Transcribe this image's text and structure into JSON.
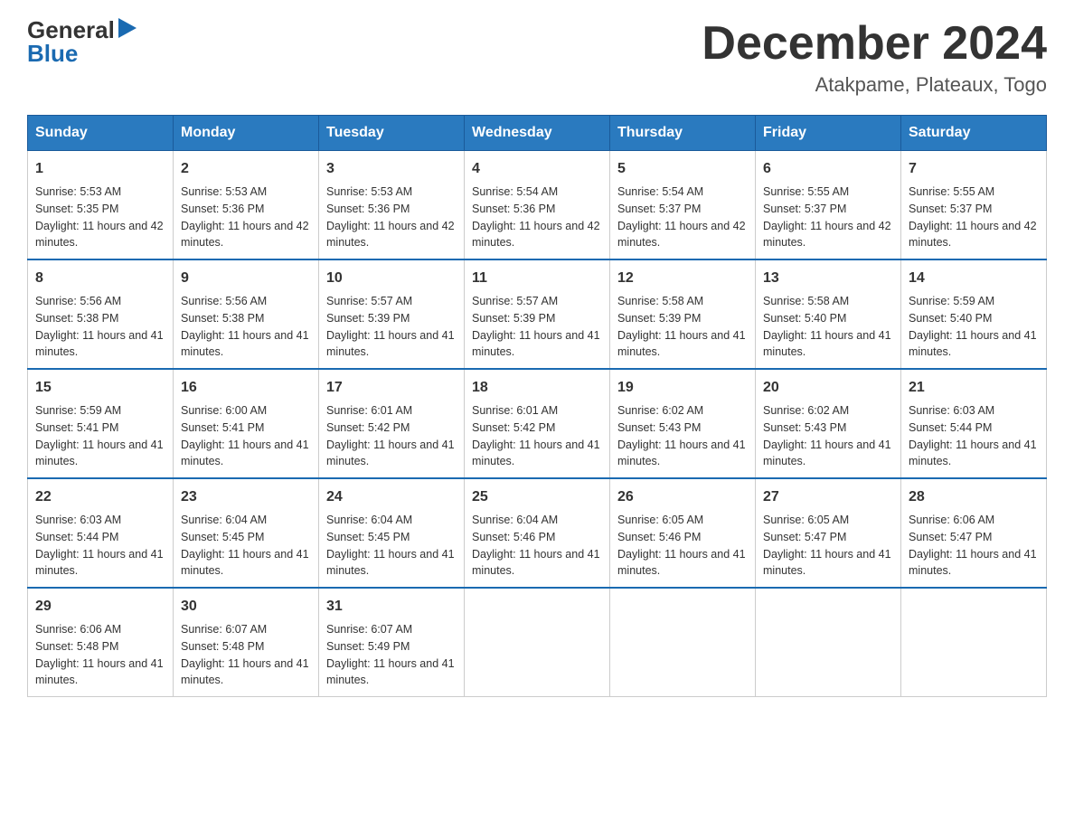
{
  "header": {
    "logo_text_general": "General",
    "logo_text_blue": "Blue",
    "month_title": "December 2024",
    "location": "Atakpame, Plateaux, Togo"
  },
  "weekdays": [
    "Sunday",
    "Monday",
    "Tuesday",
    "Wednesday",
    "Thursday",
    "Friday",
    "Saturday"
  ],
  "weeks": [
    [
      {
        "day": "1",
        "sunrise": "5:53 AM",
        "sunset": "5:35 PM",
        "daylight": "11 hours and 42 minutes."
      },
      {
        "day": "2",
        "sunrise": "5:53 AM",
        "sunset": "5:36 PM",
        "daylight": "11 hours and 42 minutes."
      },
      {
        "day": "3",
        "sunrise": "5:53 AM",
        "sunset": "5:36 PM",
        "daylight": "11 hours and 42 minutes."
      },
      {
        "day": "4",
        "sunrise": "5:54 AM",
        "sunset": "5:36 PM",
        "daylight": "11 hours and 42 minutes."
      },
      {
        "day": "5",
        "sunrise": "5:54 AM",
        "sunset": "5:37 PM",
        "daylight": "11 hours and 42 minutes."
      },
      {
        "day": "6",
        "sunrise": "5:55 AM",
        "sunset": "5:37 PM",
        "daylight": "11 hours and 42 minutes."
      },
      {
        "day": "7",
        "sunrise": "5:55 AM",
        "sunset": "5:37 PM",
        "daylight": "11 hours and 42 minutes."
      }
    ],
    [
      {
        "day": "8",
        "sunrise": "5:56 AM",
        "sunset": "5:38 PM",
        "daylight": "11 hours and 41 minutes."
      },
      {
        "day": "9",
        "sunrise": "5:56 AM",
        "sunset": "5:38 PM",
        "daylight": "11 hours and 41 minutes."
      },
      {
        "day": "10",
        "sunrise": "5:57 AM",
        "sunset": "5:39 PM",
        "daylight": "11 hours and 41 minutes."
      },
      {
        "day": "11",
        "sunrise": "5:57 AM",
        "sunset": "5:39 PM",
        "daylight": "11 hours and 41 minutes."
      },
      {
        "day": "12",
        "sunrise": "5:58 AM",
        "sunset": "5:39 PM",
        "daylight": "11 hours and 41 minutes."
      },
      {
        "day": "13",
        "sunrise": "5:58 AM",
        "sunset": "5:40 PM",
        "daylight": "11 hours and 41 minutes."
      },
      {
        "day": "14",
        "sunrise": "5:59 AM",
        "sunset": "5:40 PM",
        "daylight": "11 hours and 41 minutes."
      }
    ],
    [
      {
        "day": "15",
        "sunrise": "5:59 AM",
        "sunset": "5:41 PM",
        "daylight": "11 hours and 41 minutes."
      },
      {
        "day": "16",
        "sunrise": "6:00 AM",
        "sunset": "5:41 PM",
        "daylight": "11 hours and 41 minutes."
      },
      {
        "day": "17",
        "sunrise": "6:01 AM",
        "sunset": "5:42 PM",
        "daylight": "11 hours and 41 minutes."
      },
      {
        "day": "18",
        "sunrise": "6:01 AM",
        "sunset": "5:42 PM",
        "daylight": "11 hours and 41 minutes."
      },
      {
        "day": "19",
        "sunrise": "6:02 AM",
        "sunset": "5:43 PM",
        "daylight": "11 hours and 41 minutes."
      },
      {
        "day": "20",
        "sunrise": "6:02 AM",
        "sunset": "5:43 PM",
        "daylight": "11 hours and 41 minutes."
      },
      {
        "day": "21",
        "sunrise": "6:03 AM",
        "sunset": "5:44 PM",
        "daylight": "11 hours and 41 minutes."
      }
    ],
    [
      {
        "day": "22",
        "sunrise": "6:03 AM",
        "sunset": "5:44 PM",
        "daylight": "11 hours and 41 minutes."
      },
      {
        "day": "23",
        "sunrise": "6:04 AM",
        "sunset": "5:45 PM",
        "daylight": "11 hours and 41 minutes."
      },
      {
        "day": "24",
        "sunrise": "6:04 AM",
        "sunset": "5:45 PM",
        "daylight": "11 hours and 41 minutes."
      },
      {
        "day": "25",
        "sunrise": "6:04 AM",
        "sunset": "5:46 PM",
        "daylight": "11 hours and 41 minutes."
      },
      {
        "day": "26",
        "sunrise": "6:05 AM",
        "sunset": "5:46 PM",
        "daylight": "11 hours and 41 minutes."
      },
      {
        "day": "27",
        "sunrise": "6:05 AM",
        "sunset": "5:47 PM",
        "daylight": "11 hours and 41 minutes."
      },
      {
        "day": "28",
        "sunrise": "6:06 AM",
        "sunset": "5:47 PM",
        "daylight": "11 hours and 41 minutes."
      }
    ],
    [
      {
        "day": "29",
        "sunrise": "6:06 AM",
        "sunset": "5:48 PM",
        "daylight": "11 hours and 41 minutes."
      },
      {
        "day": "30",
        "sunrise": "6:07 AM",
        "sunset": "5:48 PM",
        "daylight": "11 hours and 41 minutes."
      },
      {
        "day": "31",
        "sunrise": "6:07 AM",
        "sunset": "5:49 PM",
        "daylight": "11 hours and 41 minutes."
      },
      null,
      null,
      null,
      null
    ]
  ]
}
